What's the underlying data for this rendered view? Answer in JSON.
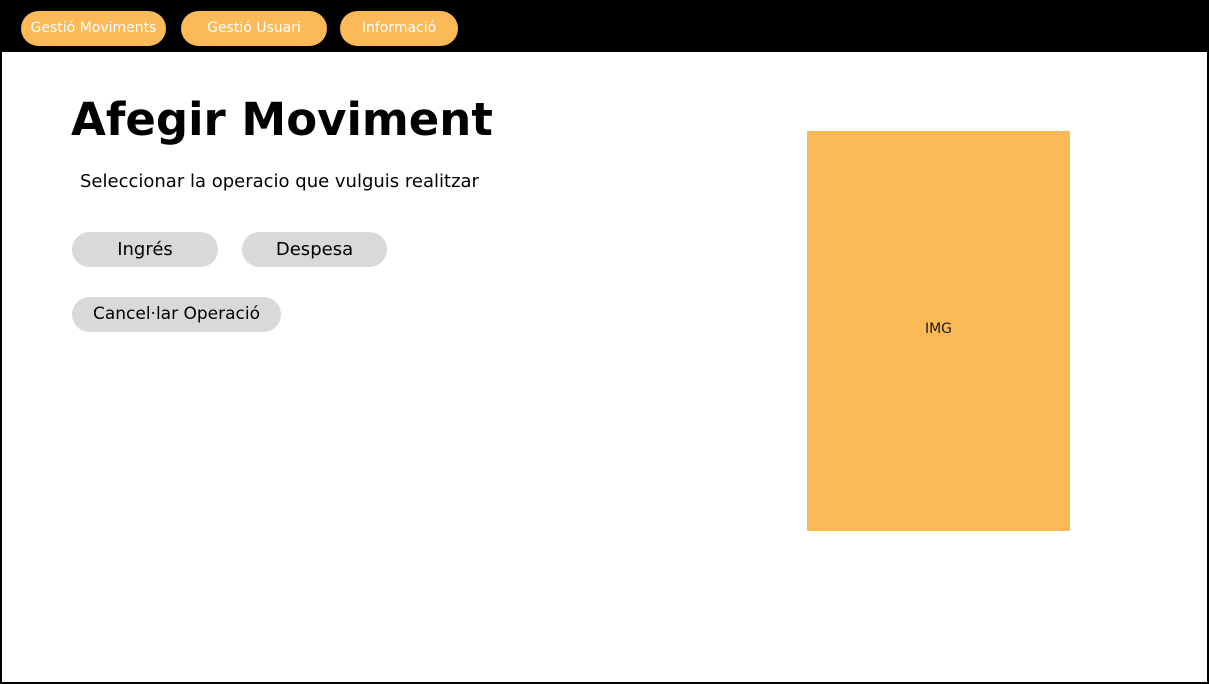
{
  "nav": {
    "items": [
      {
        "label": "Gestió Moviments"
      },
      {
        "label": "Gestió Usuari"
      },
      {
        "label": "Informació"
      }
    ]
  },
  "main": {
    "title": "Afegir Moviment",
    "subtitle": "Seleccionar la operacio que vulguis realitzar",
    "buttons": {
      "ingres": "Ingrés",
      "despesa": "Despesa",
      "cancel": "Cancel·lar Operació"
    }
  },
  "image_placeholder": {
    "label": "IMG"
  },
  "colors": {
    "accent": "#fbb957",
    "topbar": "#000000",
    "button_bg": "#d9d9d9"
  }
}
